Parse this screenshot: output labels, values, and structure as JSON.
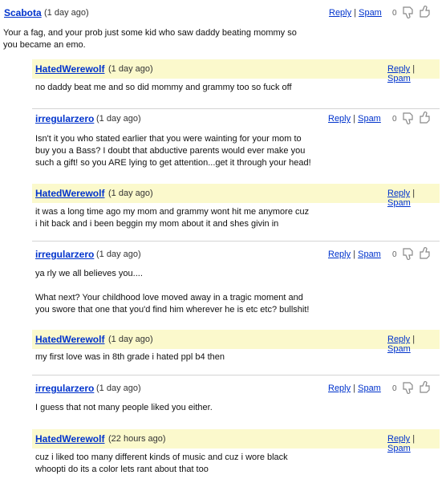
{
  "labels": {
    "reply": "Reply",
    "spam": "Spam",
    "sep": "|"
  },
  "colors": {
    "link": "#0033cc",
    "highlight": "#fbf9cc",
    "divider": "#d4d4d4"
  },
  "comments": [
    {
      "author": "Scabota",
      "time": "(1 day ago)",
      "score": "0",
      "text": "Your a fag, and your prob just some kid who saw daddy beating mommy so\nyou became an emo."
    },
    {
      "author": "HatedWerewolf",
      "time": "(1 day ago)",
      "text": "no daddy beat me and so did mommy and grammy too so fuck off"
    },
    {
      "author": "irregularzero",
      "time": "(1 day ago)",
      "score": "0",
      "text": "Isn't it you who stated earlier that you were wainting for your mom to\nbuy you a Bass? I doubt that abductive parents would ever make you\nsuch a gift! so you ARE lying to get attention...get it through your head!"
    },
    {
      "author": "HatedWerewolf",
      "time": "(1 day ago)",
      "text": "it was a long time ago my mom and grammy wont hit me anymore cuz\ni hit back and i been beggin my mom about it and shes givin in"
    },
    {
      "author": "irregularzero",
      "time": "(1 day ago)",
      "score": "0",
      "text": "ya rly we all believes you....\n\nWhat next? Your childhood love moved away in a tragic moment and\nyou swore that one that you'd find him wherever he is etc etc? bullshit!"
    },
    {
      "author": "HatedWerewolf",
      "time": "(1 day ago)",
      "text": "my first love was in 8th grade i hated ppl b4 then"
    },
    {
      "author": "irregularzero",
      "time": "(1 day ago)",
      "score": "0",
      "text": "I guess that not many people liked you either."
    },
    {
      "author": "HatedWerewolf",
      "time": "(22 hours ago)",
      "text": "cuz i liked too many different kinds of music and cuz i wore black\nwhoopti do its a color lets rant about that too"
    }
  ]
}
